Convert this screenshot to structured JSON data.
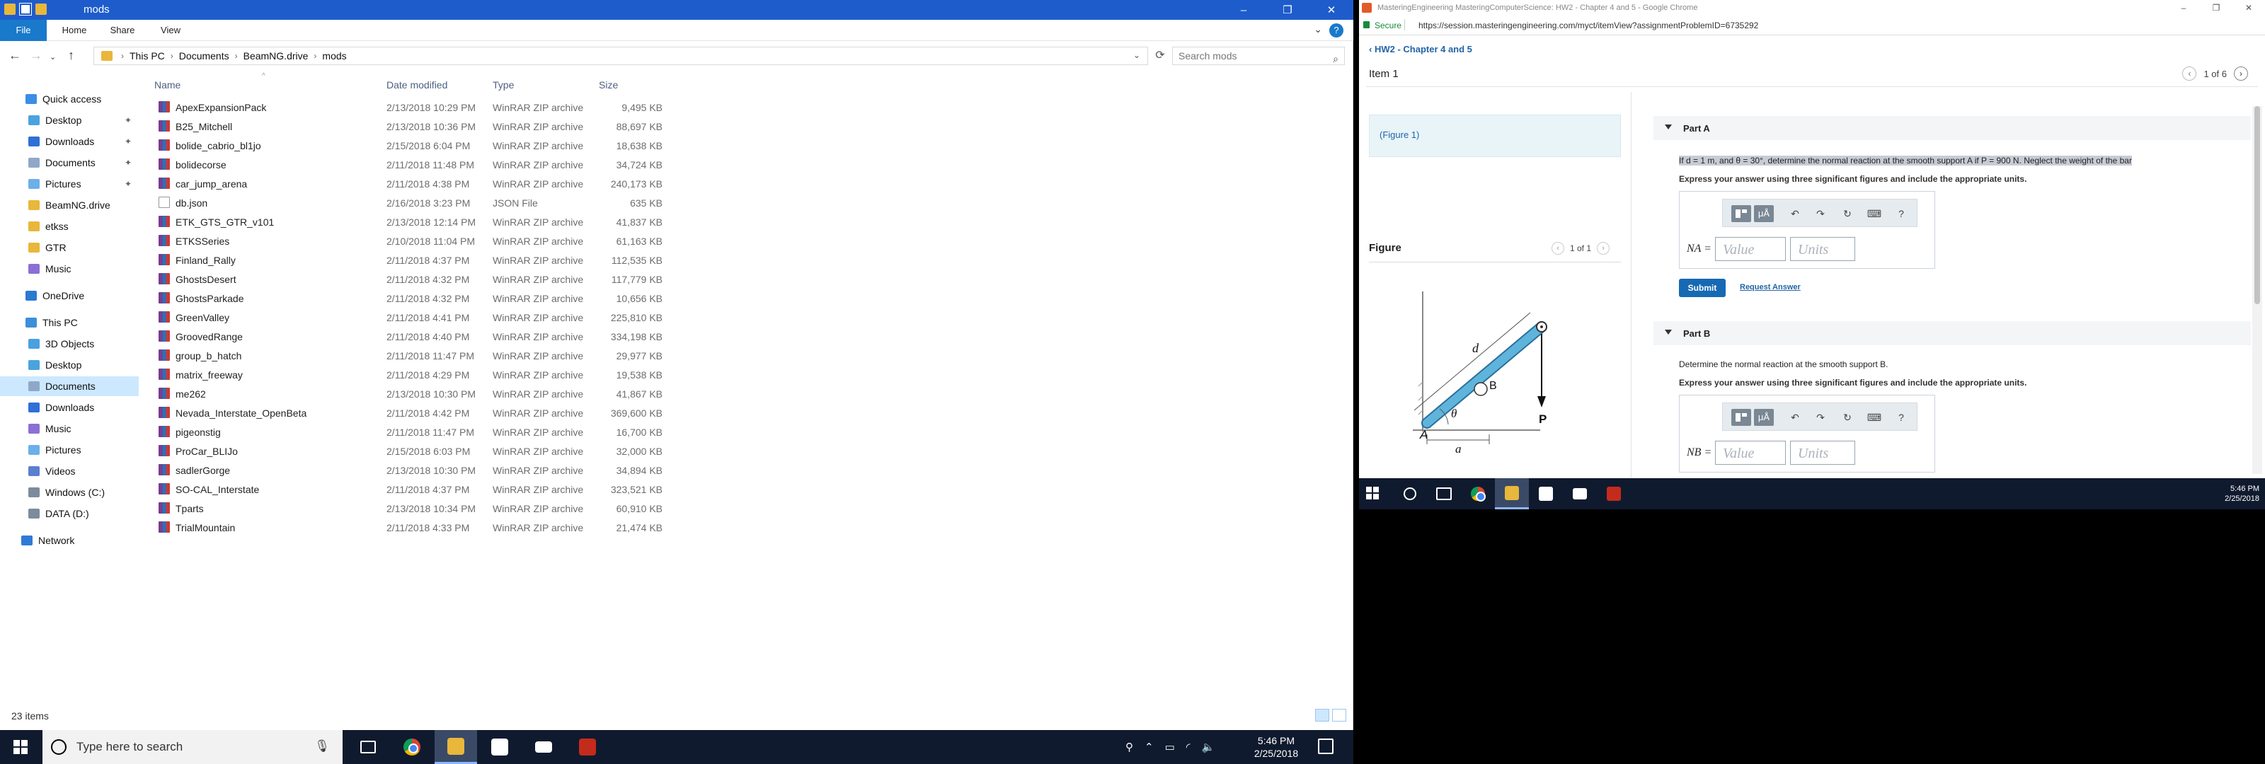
{
  "explorer": {
    "title": "mods",
    "window_controls": [
      "–",
      "❐",
      "✕"
    ],
    "ribbon_tabs": [
      "File",
      "Home",
      "Share",
      "View"
    ],
    "breadcrumb": [
      "This PC",
      "Documents",
      "BeamNG.drive",
      "mods"
    ],
    "search_placeholder": "Search mods",
    "columns": [
      "Name",
      "Date modified",
      "Type",
      "Size"
    ],
    "sidebar": [
      {
        "label": "Quick access",
        "pinned": false
      },
      {
        "label": "Desktop",
        "pinned": true
      },
      {
        "label": "Downloads",
        "pinned": true
      },
      {
        "label": "Documents",
        "pinned": true
      },
      {
        "label": "Pictures",
        "pinned": true
      },
      {
        "label": "BeamNG.drive",
        "pinned": false
      },
      {
        "label": "etkss",
        "pinned": false
      },
      {
        "label": "GTR",
        "pinned": false
      },
      {
        "label": "Music",
        "pinned": false
      },
      {
        "label": "OneDrive",
        "pinned": false
      },
      {
        "label": "This PC",
        "pinned": false
      },
      {
        "label": "3D Objects",
        "pinned": false
      },
      {
        "label": "Desktop",
        "pinned": false
      },
      {
        "label": "Documents",
        "pinned": false
      },
      {
        "label": "Downloads",
        "pinned": false
      },
      {
        "label": "Music",
        "pinned": false
      },
      {
        "label": "Pictures",
        "pinned": false
      },
      {
        "label": "Videos",
        "pinned": false
      },
      {
        "label": "Windows (C:)",
        "pinned": false
      },
      {
        "label": "DATA (D:)",
        "pinned": false
      },
      {
        "label": "Network",
        "pinned": false
      }
    ],
    "files": [
      {
        "name": "ApexExpansionPack",
        "date": "2/13/2018 10:29 PM",
        "type": "WinRAR ZIP archive",
        "size": "9,495 KB"
      },
      {
        "name": "B25_Mitchell",
        "date": "2/13/2018 10:36 PM",
        "type": "WinRAR ZIP archive",
        "size": "88,697 KB"
      },
      {
        "name": "bolide_cabrio_bl1jo",
        "date": "2/15/2018 6:04 PM",
        "type": "WinRAR ZIP archive",
        "size": "18,638 KB"
      },
      {
        "name": "bolidecorse",
        "date": "2/11/2018 11:48 PM",
        "type": "WinRAR ZIP archive",
        "size": "34,724 KB"
      },
      {
        "name": "car_jump_arena",
        "date": "2/11/2018 4:38 PM",
        "type": "WinRAR ZIP archive",
        "size": "240,173 KB"
      },
      {
        "name": "db.json",
        "date": "2/16/2018 3:23 PM",
        "type": "JSON File",
        "size": "635 KB"
      },
      {
        "name": "ETK_GTS_GTR_v101",
        "date": "2/13/2018 12:14 PM",
        "type": "WinRAR ZIP archive",
        "size": "41,837 KB"
      },
      {
        "name": "ETKSSeries",
        "date": "2/10/2018 11:04 PM",
        "type": "WinRAR ZIP archive",
        "size": "61,163 KB"
      },
      {
        "name": "Finland_Rally",
        "date": "2/11/2018 4:37 PM",
        "type": "WinRAR ZIP archive",
        "size": "112,535 KB"
      },
      {
        "name": "GhostsDesert",
        "date": "2/11/2018 4:32 PM",
        "type": "WinRAR ZIP archive",
        "size": "117,779 KB"
      },
      {
        "name": "GhostsParkade",
        "date": "2/11/2018 4:32 PM",
        "type": "WinRAR ZIP archive",
        "size": "10,656 KB"
      },
      {
        "name": "GreenValley",
        "date": "2/11/2018 4:41 PM",
        "type": "WinRAR ZIP archive",
        "size": "225,810 KB"
      },
      {
        "name": "GroovedRange",
        "date": "2/11/2018 4:40 PM",
        "type": "WinRAR ZIP archive",
        "size": "334,198 KB"
      },
      {
        "name": "group_b_hatch",
        "date": "2/11/2018 11:47 PM",
        "type": "WinRAR ZIP archive",
        "size": "29,977 KB"
      },
      {
        "name": "matrix_freeway",
        "date": "2/11/2018 4:29 PM",
        "type": "WinRAR ZIP archive",
        "size": "19,538 KB"
      },
      {
        "name": "me262",
        "date": "2/13/2018 10:30 PM",
        "type": "WinRAR ZIP archive",
        "size": "41,867 KB"
      },
      {
        "name": "Nevada_Interstate_OpenBeta",
        "date": "2/11/2018 4:42 PM",
        "type": "WinRAR ZIP archive",
        "size": "369,600 KB"
      },
      {
        "name": "pigeonstig",
        "date": "2/11/2018 11:47 PM",
        "type": "WinRAR ZIP archive",
        "size": "16,700 KB"
      },
      {
        "name": "ProCar_BLIJo",
        "date": "2/15/2018 6:03 PM",
        "type": "WinRAR ZIP archive",
        "size": "32,000 KB"
      },
      {
        "name": "sadlerGorge",
        "date": "2/13/2018 10:30 PM",
        "type": "WinRAR ZIP archive",
        "size": "34,894 KB"
      },
      {
        "name": "SO-CAL_Interstate",
        "date": "2/11/2018 4:37 PM",
        "type": "WinRAR ZIP archive",
        "size": "323,521 KB"
      },
      {
        "name": "Tparts",
        "date": "2/13/2018 10:34 PM",
        "type": "WinRAR ZIP archive",
        "size": "60,910 KB"
      },
      {
        "name": "TrialMountain",
        "date": "2/11/2018 4:33 PM",
        "type": "WinRAR ZIP archive",
        "size": "21,474 KB"
      }
    ],
    "status": "23 items"
  },
  "taskbar": {
    "search_placeholder": "Type here to search",
    "time": "5:46 PM",
    "date": "2/25/2018"
  },
  "chrome": {
    "title": "MasteringEngineering MasteringComputerScience: HW2 - Chapter 4 and 5 - Google Chrome",
    "secure_label": "Secure",
    "url": "https://session.masteringengineering.com/myct/itemView?assignmentProblemID=6735292",
    "hw_link": "‹ HW2 - Chapter 4 and 5",
    "item_title": "Item 1",
    "item_pager": "1 of 6",
    "figure_link": "(Figure 1)",
    "figure_title": "Figure",
    "figure_pager": "1 of 1",
    "diagram_labels": {
      "d": "d",
      "B": "B",
      "P": "P",
      "theta": "θ",
      "A": "A",
      "a": "a"
    },
    "part_a": {
      "label": "Part A",
      "question": "If d = 1 m, and θ = 30°, determine the normal reaction at the smooth support A if P = 900 N. Neglect the weight of the bar",
      "instructions": "Express your answer using three significant figures and include the appropriate units.",
      "answer_label": "NA =",
      "value_placeholder": "Value",
      "units_placeholder": "Units",
      "submit": "Submit",
      "request": "Request Answer"
    },
    "part_b": {
      "label": "Part B",
      "question": "Determine the normal reaction at the smooth support B.",
      "instructions": "Express your answer using three significant figures and include the appropriate units.",
      "answer_label": "NB =",
      "value_placeholder": "Value",
      "units_placeholder": "Units"
    },
    "toolbar_mu": "μÅ",
    "toolbar_help": "?",
    "time": "5:46 PM",
    "date": "2/25/2018"
  },
  "colors": {
    "explorer_title": "#1e5ccc",
    "accent": "#1979ca",
    "link": "#2364a8",
    "submit": "#1769b3",
    "taskbar": "#101a2e"
  }
}
